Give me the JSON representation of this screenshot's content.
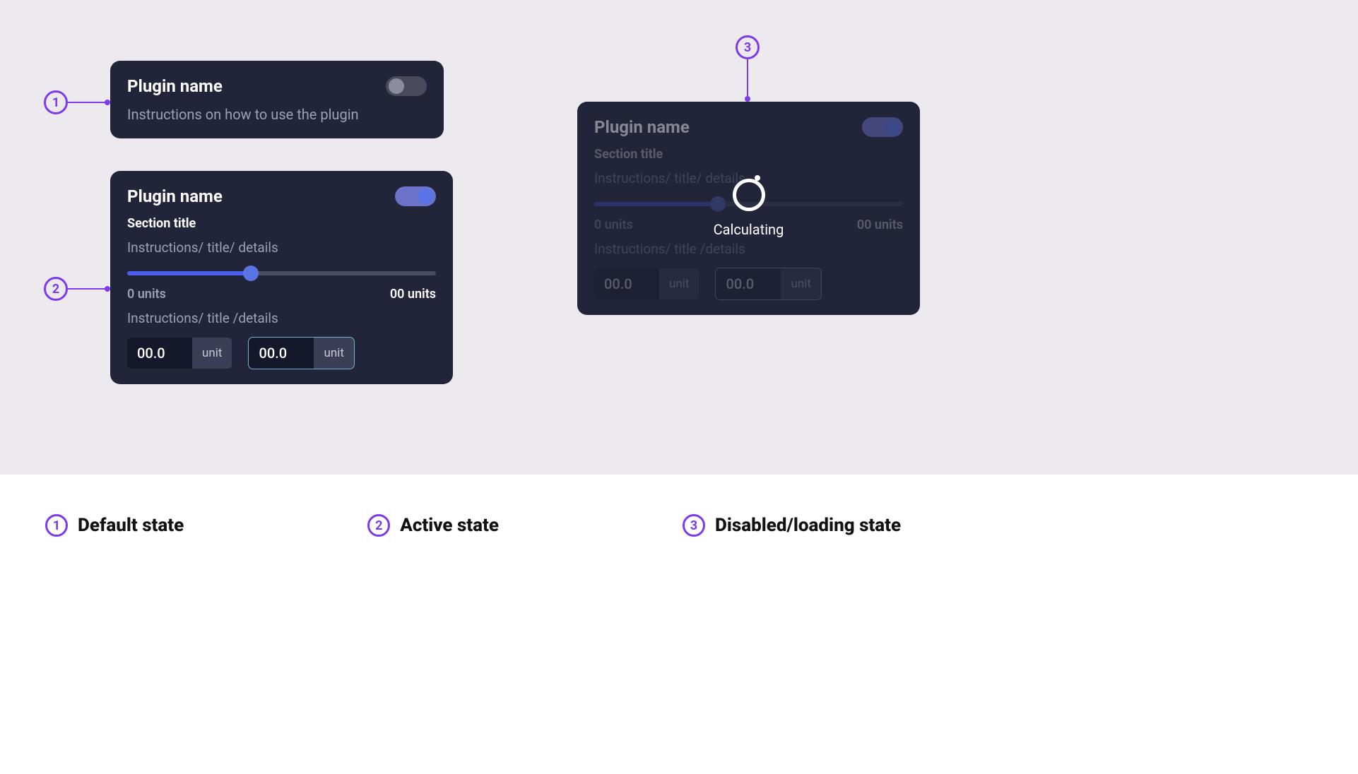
{
  "callouts": {
    "c1": "1",
    "c2": "2",
    "c3": "3"
  },
  "card1": {
    "title": "Plugin name",
    "subtitle": "Instructions on how to use the plugin",
    "toggle_on": false
  },
  "card2": {
    "title": "Plugin name",
    "section": "Section title",
    "instructions1": "Instructions/ title/ details",
    "slider_min": "0 units",
    "slider_max": "00 units",
    "instructions2": "Instructions/ title /details",
    "input1": {
      "value": "00.0",
      "unit": "unit"
    },
    "input2": {
      "value": "00.0",
      "unit": "unit"
    },
    "toggle_on": true
  },
  "card3": {
    "title": "Plugin name",
    "section": "Section title",
    "instructions1": "Instructions/ title/ details",
    "slider_min": "0 units",
    "slider_max": "00 units",
    "instructions2": "Instructions/ title /details",
    "input1": {
      "value": "00.0",
      "unit": "unit"
    },
    "input2": {
      "value": "00.0",
      "unit": "unit"
    },
    "toggle_on": true,
    "overlay_text": "Calculating"
  },
  "legend": {
    "item1": {
      "num": "1",
      "label": "Default state"
    },
    "item2": {
      "num": "2",
      "label": "Active state"
    },
    "item3": {
      "num": "3",
      "label": "Disabled/loading state"
    }
  }
}
